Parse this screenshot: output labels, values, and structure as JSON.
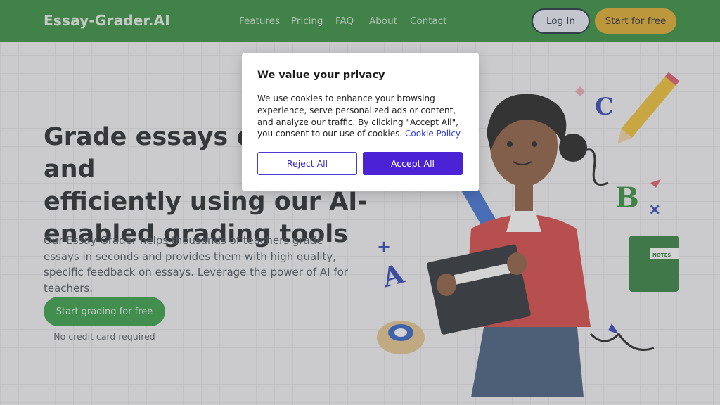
{
  "header": {
    "logo": "Essay-Grader.AI",
    "nav": [
      "Features",
      "Pricing",
      "FAQ",
      "About",
      "Contact"
    ],
    "login_label": "Log In",
    "start_label": "Start for free"
  },
  "hero": {
    "title_lines": [
      "Grade essays quickly and",
      "efficiently using our AI-",
      "enabled grading tools"
    ],
    "description": "Our Essay Grader helps thousands of teachers grade essays in seconds and provides them with high quality, specific feedback on essays. Leverage the power of AI for teachers.",
    "cta_label": "Start grading for free",
    "cta_note": "No credit card required"
  },
  "illustration": {
    "letters": [
      "C",
      "B",
      "A"
    ],
    "notebook_label": "NOTES"
  },
  "cookie_modal": {
    "title": "We value your privacy",
    "text": "We use cookies to enhance your browsing experience, serve personalized ads or content, and analyze our traffic. By clicking \"Accept All\", you consent to our use of cookies.",
    "link_label": "Cookie Policy",
    "reject_label": "Reject All",
    "accept_label": "Accept All"
  },
  "colors": {
    "header_bg": "#2e8b3a",
    "accent_yellow": "#e0a927",
    "cta_green": "#2e9c43",
    "accept_purple": "#4b22d4"
  }
}
